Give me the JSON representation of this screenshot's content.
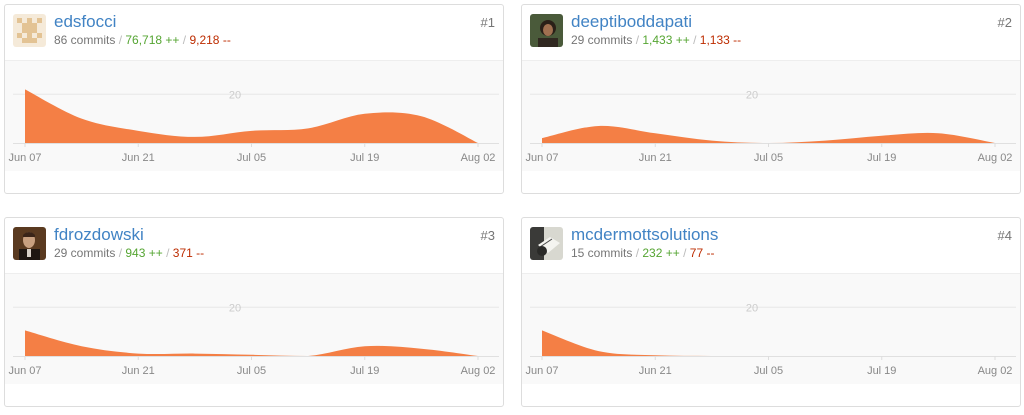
{
  "colors": {
    "link": "#4183c4",
    "additions": "#55a532",
    "deletions": "#bd2c00",
    "area_fill": "#f47f45"
  },
  "contributors": [
    {
      "username": "edsfocci",
      "commits": "86 commits",
      "additions": "76,718 ++",
      "deletions": "9,218 --",
      "rank": "#1",
      "avatar_icon": "identicon-avatar"
    },
    {
      "username": "deeptiboddapati",
      "commits": "29 commits",
      "additions": "1,433 ++",
      "deletions": "1,133 --",
      "rank": "#2",
      "avatar_icon": "photo-avatar"
    },
    {
      "username": "fdrozdowski",
      "commits": "29 commits",
      "additions": "943 ++",
      "deletions": "371 --",
      "rank": "#3",
      "avatar_icon": "photo-avatar"
    },
    {
      "username": "mcdermottsolutions",
      "commits": "15 commits",
      "additions": "232 ++",
      "deletions": "77 --",
      "rank": "#4",
      "avatar_icon": "photo-avatar"
    }
  ],
  "chart_data": [
    {
      "type": "area",
      "series": [
        {
          "values": [
            22,
            10,
            5,
            2.5,
            5,
            6,
            12,
            11,
            0
          ]
        }
      ],
      "x": [
        "Jun 07",
        "Jun 14",
        "Jun 21",
        "Jun 28",
        "Jul 05",
        "Jul 12",
        "Jul 19",
        "Jul 26",
        "Aug 02"
      ],
      "xticks": [
        "Jun 07",
        "Jun 21",
        "Jul 05",
        "Jul 19",
        "Aug 02"
      ],
      "yticks": [
        "20"
      ],
      "ylim": [
        0,
        32
      ]
    },
    {
      "type": "area",
      "series": [
        {
          "values": [
            2,
            7,
            4,
            1,
            0,
            1,
            3,
            4,
            0
          ]
        }
      ],
      "x": [
        "Jun 07",
        "Jun 14",
        "Jun 21",
        "Jun 28",
        "Jul 05",
        "Jul 12",
        "Jul 19",
        "Jul 26",
        "Aug 02"
      ],
      "xticks": [
        "Jun 07",
        "Jun 21",
        "Jul 05",
        "Jul 19",
        "Aug 02"
      ],
      "yticks": [
        "20"
      ],
      "ylim": [
        0,
        32
      ]
    },
    {
      "type": "area",
      "series": [
        {
          "values": [
            10.5,
            4,
            1,
            1,
            0.5,
            0,
            4,
            3,
            0
          ]
        }
      ],
      "x": [
        "Jun 07",
        "Jun 14",
        "Jun 21",
        "Jun 28",
        "Jul 05",
        "Jul 12",
        "Jul 19",
        "Jul 26",
        "Aug 02"
      ],
      "xticks": [
        "Jun 07",
        "Jun 21",
        "Jul 05",
        "Jul 19",
        "Aug 02"
      ],
      "yticks": [
        "20"
      ],
      "ylim": [
        0,
        32
      ]
    },
    {
      "type": "area",
      "series": [
        {
          "values": [
            10.5,
            2,
            0.3,
            0,
            0,
            0,
            0,
            0,
            0
          ]
        }
      ],
      "x": [
        "Jun 07",
        "Jun 14",
        "Jun 21",
        "Jun 28",
        "Jul 05",
        "Jul 12",
        "Jul 19",
        "Jul 26",
        "Aug 02"
      ],
      "xticks": [
        "Jun 07",
        "Jun 21",
        "Jul 05",
        "Jul 19",
        "Aug 02"
      ],
      "yticks": [
        "20"
      ],
      "ylim": [
        0,
        32
      ]
    }
  ]
}
